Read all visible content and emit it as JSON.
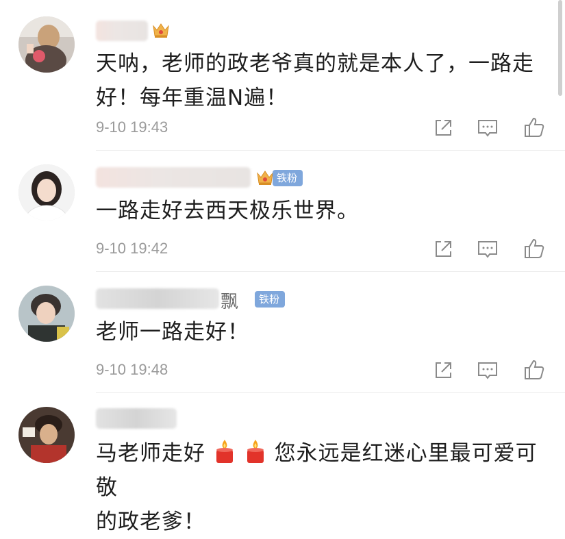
{
  "comments": [
    {
      "text": "天呐，老师的政老爷真的就是本人了，一路走好！每年重温N遍！",
      "time": "9-10 19:43"
    },
    {
      "badge": "铁粉",
      "text": "一路走好去西天极乐世界。",
      "time": "9-10 19:42"
    },
    {
      "badge": "铁粉",
      "name_suffix": "飘",
      "text": "老师一路走好！",
      "time": "9-10 19:48"
    },
    {
      "text_before": "马老师走好",
      "text_after": "您永远是红迷心里最可爱可敬",
      "text_line2": "的政老爹！"
    }
  ],
  "icons": {
    "share": "share-icon",
    "comment": "comment-icon",
    "like": "like-icon",
    "crown": "crown-icon",
    "candle": "candle-icon"
  },
  "colors": {
    "badge": "#7fa7dc",
    "time": "#9a9a9a",
    "text": "#1e1e1e",
    "crown": "#f0b24a"
  }
}
